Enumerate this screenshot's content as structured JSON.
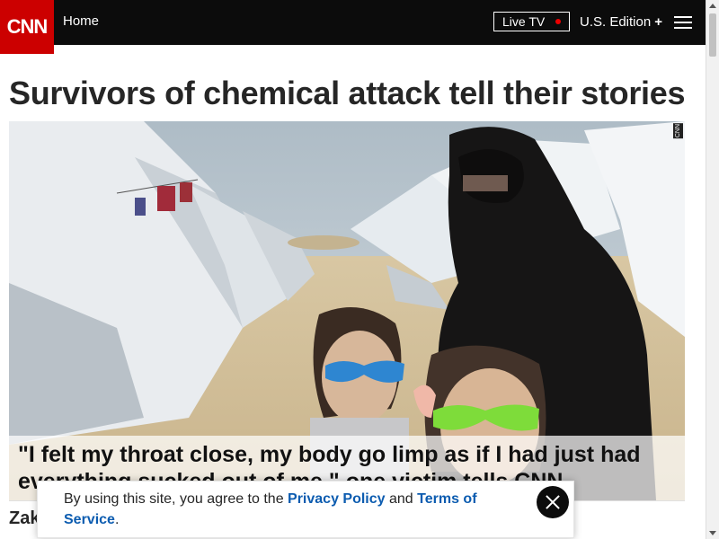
{
  "header": {
    "logo_text": "CNN",
    "home_label": "Home",
    "live_tv_label": "Live TV",
    "edition_label": "U.S. Edition",
    "edition_plus": "+",
    "brand_color": "#cc0000",
    "bar_color": "#0c0c0c"
  },
  "article": {
    "headline": "Survivors of chemical attack tell their stories",
    "media_caption": "\"I felt my throat close, my body go limp as if I had just had everything sucked out of me,\" one victim tells CNN.",
    "media_bug": "CNN",
    "byline_visible": "Zak"
  },
  "consent": {
    "text_before": "By using this site, you agree to the ",
    "privacy_link": "Privacy Policy",
    "text_middle": " and ",
    "terms_link": "Terms of Service",
    "text_after": ".",
    "link_color": "#0c5cb0"
  },
  "icons": {
    "menu": "hamburger-menu-icon",
    "close": "close-icon",
    "live_indicator": "red-dot-icon"
  }
}
